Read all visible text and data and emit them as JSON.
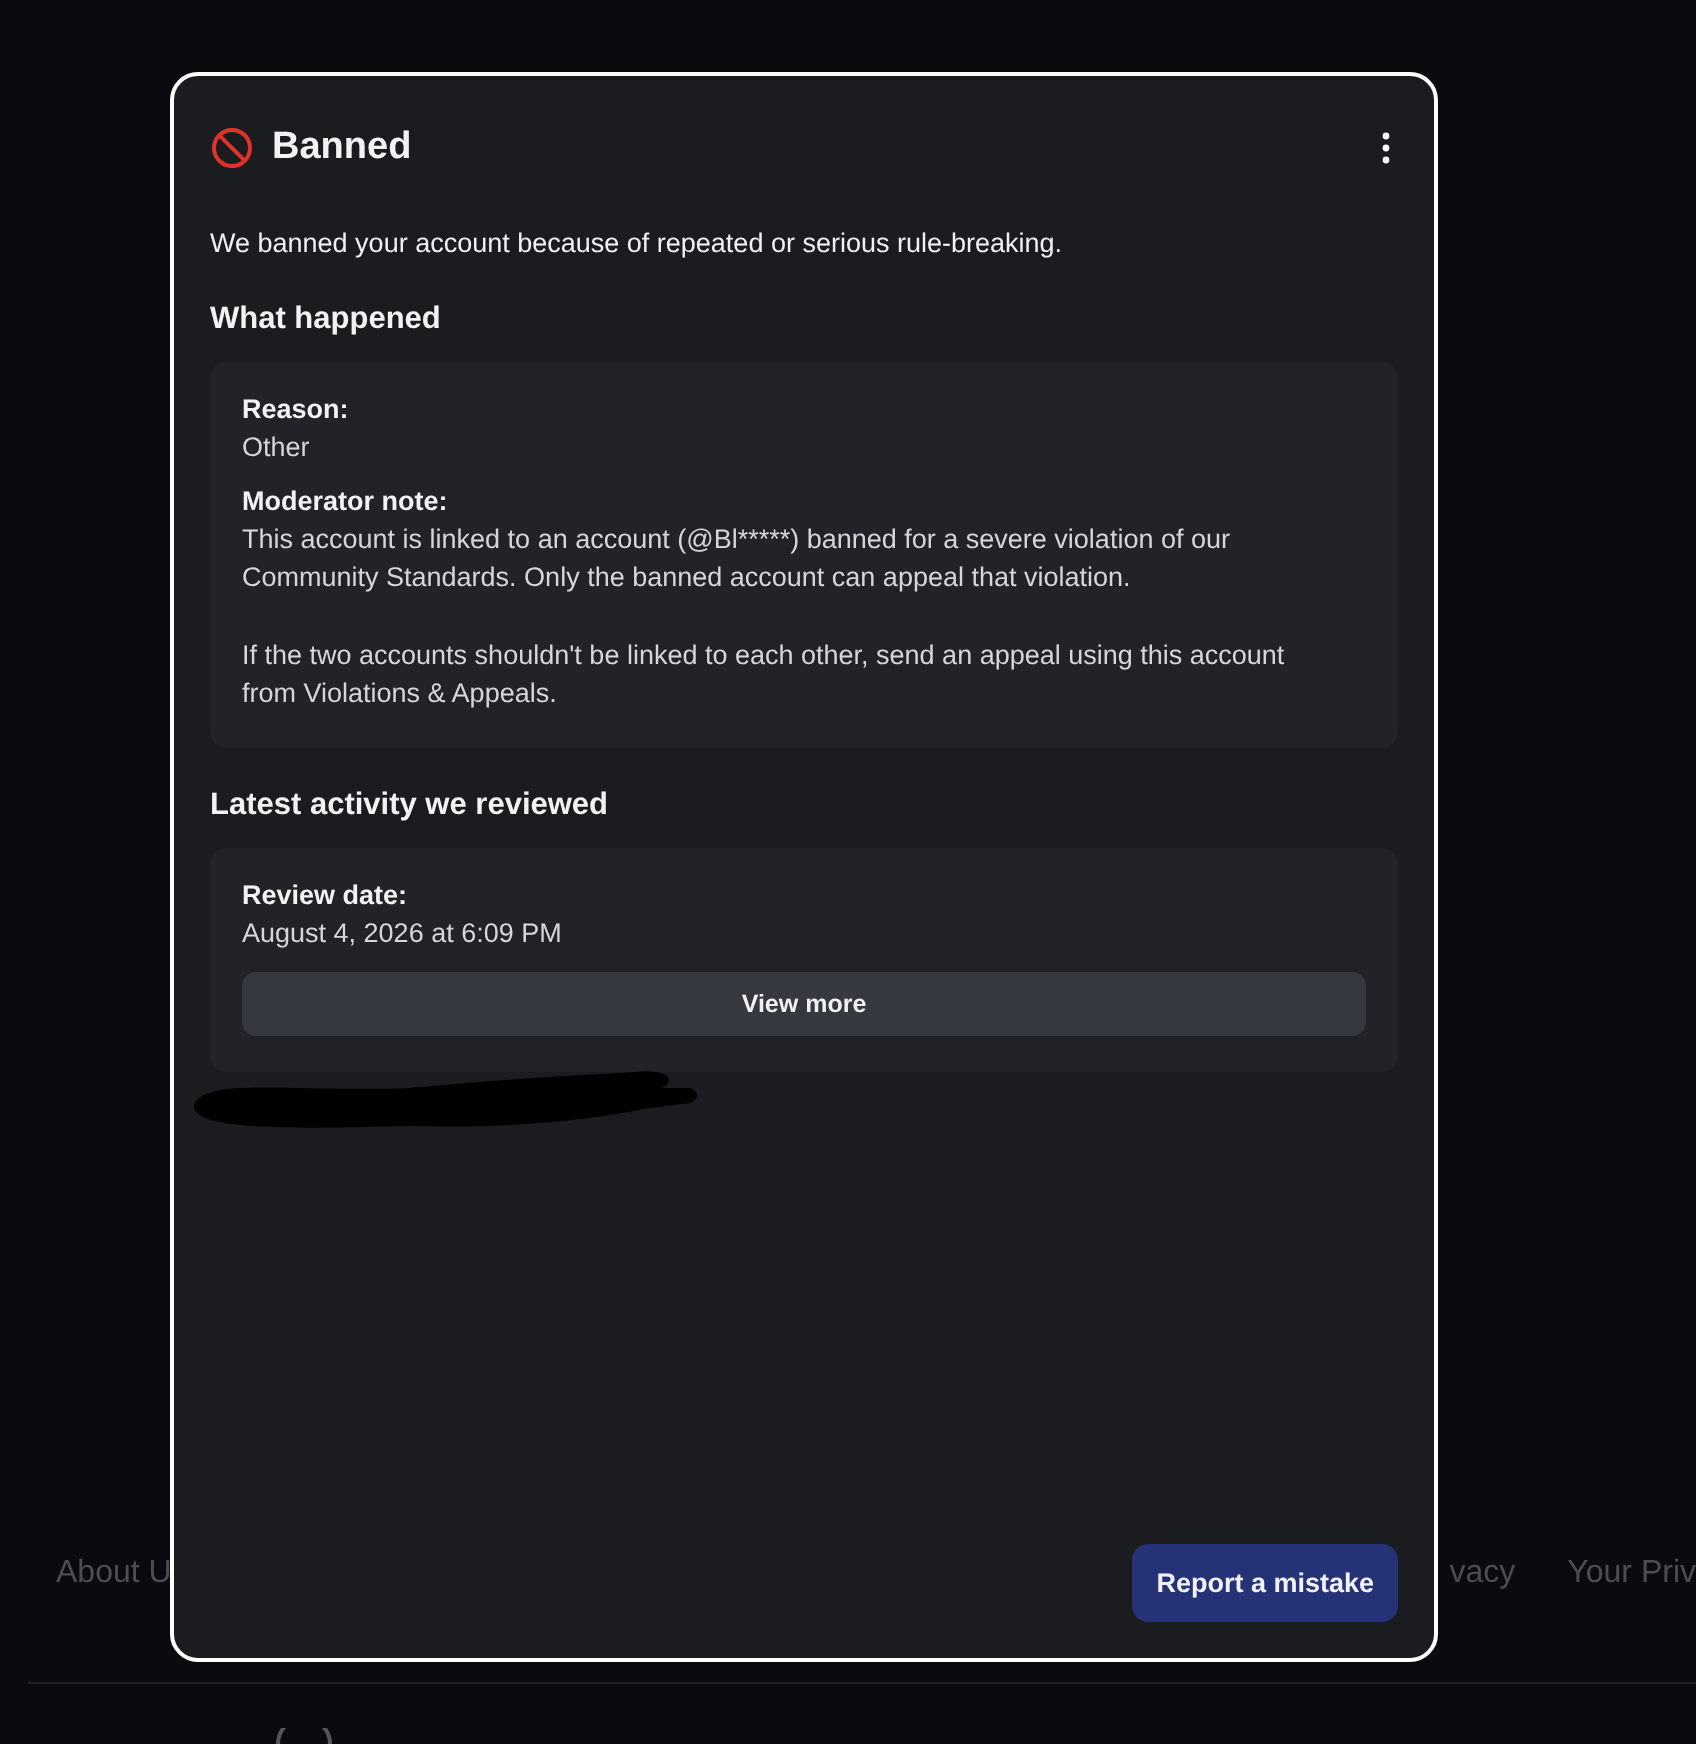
{
  "footer": {
    "links": [
      "About U",
      "vacy",
      "Your Priv"
    ]
  },
  "dialog": {
    "title": "Banned",
    "intro": "We banned your account because of repeated or serious rule-breaking.",
    "sections": [
      {
        "heading": "What happened",
        "fields": [
          {
            "label": "Reason:",
            "paragraphs": [
              "Other"
            ]
          },
          {
            "label": "Moderator note:",
            "paragraphs": [
              "This account is linked to an account (@Bl*****) banned for a severe violation of our Community Standards. Only the banned account can appeal that violation.",
              "If the two accounts shouldn't be linked to each other, send an appeal using this account from Violations & Appeals."
            ]
          }
        ]
      },
      {
        "heading": "Latest activity we reviewed",
        "fields": [
          {
            "label": "Review date:",
            "paragraphs": [
              "August 4, 2026 at 6:09 PM"
            ]
          }
        ],
        "button": "View more"
      }
    ],
    "primary_button": "Report a mistake"
  }
}
